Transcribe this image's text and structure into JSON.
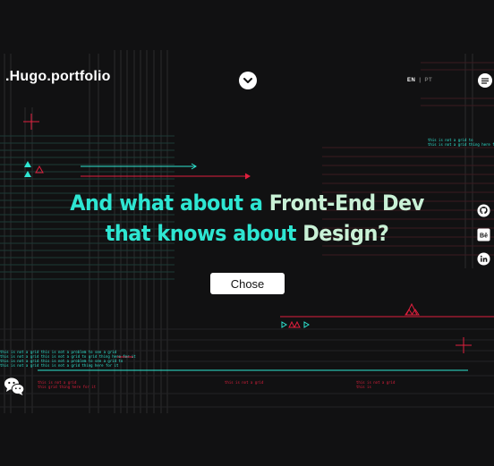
{
  "header": {
    "logo": ".Hugo.portfolio",
    "lang_active": "EN",
    "lang_separator": "|",
    "lang_inactive": "PT"
  },
  "hero": {
    "line1_part1": "And what about a ",
    "line1_part2": "Front-End Dev",
    "line2_part1": "that knows about ",
    "line2_part2": "Design?",
    "cta_label": "Chose"
  },
  "social": [
    "github-icon",
    "behance-icon",
    "linkedin-icon"
  ],
  "colors": {
    "background": "#111112",
    "teal": "#2ee6d2",
    "red": "#e01f3d",
    "pale": "#c9f1d6"
  },
  "decor": {
    "top_right_note": "this is not a grid to\nthis is not a grid thing here for it",
    "left_note_teal": "this is not a grid this is not a problem to see a grid\nthis is not a grid this is not a grid to grid thing here for it\nthis is not a grid this is not a problem to see a grid to\nthis is not a grid this is not a grid thing here for it",
    "bottom_note_1": "this is not a grid\nthis grid thing here for it",
    "bottom_note_2": "this is not a grid",
    "bottom_note_3": "this is not a grid\nthis is"
  }
}
